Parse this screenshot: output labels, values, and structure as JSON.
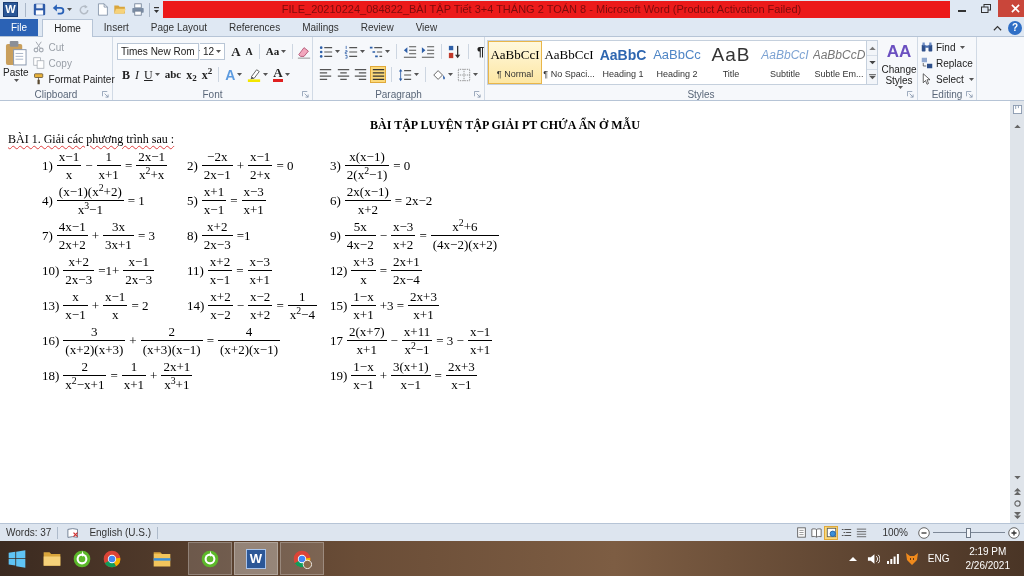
{
  "title_bar": {
    "app_glyph": "W",
    "quick_access": {
      "redo": {
        "disabled": true
      }
    },
    "title": "FILE_20210224_084822_BÀI TẬP Tiết 3+4 THÁNG 2 TOÁN 8 - Microsoft Word (Product Activation Failed)"
  },
  "tabs": [
    {
      "label": "File",
      "kind": "file",
      "selected": false
    },
    {
      "label": "Home",
      "kind": "tab",
      "selected": true
    },
    {
      "label": "Insert",
      "kind": "tab",
      "selected": false
    },
    {
      "label": "Page Layout",
      "kind": "tab",
      "selected": false
    },
    {
      "label": "References",
      "kind": "tab",
      "selected": false
    },
    {
      "label": "Mailings",
      "kind": "tab",
      "selected": false
    },
    {
      "label": "Review",
      "kind": "tab",
      "selected": false
    },
    {
      "label": "View",
      "kind": "tab",
      "selected": false
    }
  ],
  "help_glyph": "?",
  "ribbon": {
    "clipboard": {
      "label": "Clipboard",
      "paste": "Paste",
      "commands": [
        {
          "label": "Cut",
          "kind": "cut",
          "disabled": true
        },
        {
          "label": "Copy",
          "kind": "copy",
          "disabled": true
        },
        {
          "label": "Format Painter",
          "kind": "painter",
          "disabled": false
        }
      ]
    },
    "font": {
      "label": "Font",
      "font_name": "Times New Rom",
      "font_size": "12",
      "grow": "A",
      "shrink": "A",
      "change_case": "Aa",
      "bold": "B",
      "italic": "I",
      "underline": "U",
      "strikethrough": "abc",
      "subscript": "x$_{2}$",
      "superscript": "x$^{2}$",
      "text_effects": "A",
      "font_color": "A"
    },
    "paragraph": {
      "label": "Paragraph",
      "marks_glyph": "¶",
      "alignment": [
        {
          "kind": "left",
          "selected": false
        },
        {
          "kind": "center",
          "selected": false
        },
        {
          "kind": "right",
          "selected": false
        },
        {
          "kind": "justify",
          "selected": true
        }
      ]
    },
    "styles": {
      "label": "Styles",
      "items": [
        {
          "preview": "AaBbCcI",
          "name": "¶ Normal",
          "kind": "normal",
          "selected": true
        },
        {
          "preview": "AaBbCcI",
          "name": "¶ No Spaci...",
          "kind": "plain",
          "selected": false
        },
        {
          "preview": "AaBbC",
          "name": "Heading 1",
          "kind": "heading1",
          "selected": false
        },
        {
          "preview": "AaBbCc",
          "name": "Heading 2",
          "kind": "heading2",
          "selected": false
        },
        {
          "preview": "AaB",
          "name": "Title",
          "kind": "title",
          "selected": false
        },
        {
          "preview": "AaBbCcI",
          "name": "Subtitle",
          "kind": "subtitle",
          "selected": false
        },
        {
          "preview": "AaBbCcD",
          "name": "Subtle Em...",
          "kind": "emphasis",
          "selected": false
        }
      ],
      "change_styles": {
        "glyph": "AA",
        "label": "Change Styles"
      }
    },
    "editing": {
      "label": "Editing",
      "commands": [
        {
          "label": "Find",
          "kind": "find",
          "dropdown": true
        },
        {
          "label": "Replace",
          "kind": "replace",
          "dropdown": false
        },
        {
          "label": "Select",
          "kind": "select",
          "dropdown": true
        }
      ]
    }
  },
  "document": {
    "heading": "BÀI TẬP LUYỆN TẬP GIẢI PT CHỨA ẨN Ở MẪU",
    "exercise": {
      "text": "BÀI 1. Giải các phương trình sau :",
      "flagged": true
    },
    "rows": [
      [
        {
          "label": "1)",
          "terms": [
            {
              "kind": "frac",
              "num": "x−1",
              "den": "x"
            },
            {
              "kind": "text",
              "text": "−"
            },
            {
              "kind": "frac",
              "num": "1",
              "den": "x+1"
            },
            {
              "kind": "text",
              "text": "="
            },
            {
              "kind": "frac",
              "num": "2x−1",
              "den": "x$^{2}$+x"
            }
          ]
        },
        {
          "label": "2)",
          "terms": [
            {
              "kind": "frac",
              "num": "−2x",
              "den": "2x−1"
            },
            {
              "kind": "text",
              "text": "+"
            },
            {
              "kind": "frac",
              "num": "x−1",
              "den": "2+x"
            },
            {
              "kind": "text",
              "text": "= 0"
            }
          ]
        },
        {
          "label": "3)",
          "terms": [
            {
              "kind": "frac",
              "num": "x(x−1)",
              "den": "2(x$^{2}$−1)"
            },
            {
              "kind": "text",
              "text": "= 0"
            }
          ]
        }
      ],
      [
        {
          "label": "4)",
          "terms": [
            {
              "kind": "frac",
              "num": "(x−1)(x$^{2}$+2)",
              "den": "x$^{3}$−1"
            },
            {
              "kind": "text",
              "text": "= 1"
            }
          ]
        },
        {
          "label": "5)",
          "terms": [
            {
              "kind": "frac",
              "num": "x+1",
              "den": "x−1"
            },
            {
              "kind": "text",
              "text": "="
            },
            {
              "kind": "frac",
              "num": "x−3",
              "den": "x+1"
            }
          ]
        },
        {
          "label": "6)",
          "terms": [
            {
              "kind": "frac",
              "num": "2x(x−1)",
              "den": "x+2"
            },
            {
              "kind": "text",
              "text": "= 2x−2"
            }
          ]
        }
      ],
      [
        {
          "label": "7)",
          "terms": [
            {
              "kind": "frac",
              "num": "4x−1",
              "den": "2x+2"
            },
            {
              "kind": "text",
              "text": "+"
            },
            {
              "kind": "frac",
              "num": "3x",
              "den": "3x+1"
            },
            {
              "kind": "text",
              "text": "= 3"
            }
          ]
        },
        {
          "label": "8)",
          "terms": [
            {
              "kind": "frac",
              "num": "x+2",
              "den": "2x−3"
            },
            {
              "kind": "text",
              "text": "=1"
            }
          ]
        },
        {
          "label": "9)",
          "terms": [
            {
              "kind": "frac",
              "num": "5x",
              "den": "4x−2"
            },
            {
              "kind": "text",
              "text": "−"
            },
            {
              "kind": "frac",
              "num": "x−3",
              "den": "x+2"
            },
            {
              "kind": "text",
              "text": "="
            },
            {
              "kind": "frac",
              "num": "x$^{2}$+6",
              "den": "(4x−2)(x+2)"
            }
          ]
        }
      ],
      [
        {
          "label": "10)",
          "terms": [
            {
              "kind": "frac",
              "num": "x+2",
              "den": "2x−3"
            },
            {
              "kind": "text",
              "text": "=1+"
            },
            {
              "kind": "frac",
              "num": "x−1",
              "den": "2x−3"
            }
          ]
        },
        {
          "label": "11)",
          "terms": [
            {
              "kind": "frac",
              "num": "x+2",
              "den": "x−1"
            },
            {
              "kind": "text",
              "text": "="
            },
            {
              "kind": "frac",
              "num": "x−3",
              "den": "x+1"
            }
          ]
        },
        {
          "label": "12)",
          "terms": [
            {
              "kind": "frac",
              "num": "x+3",
              "den": "x"
            },
            {
              "kind": "text",
              "text": "="
            },
            {
              "kind": "frac",
              "num": "2x+1",
              "den": "2x−4"
            }
          ]
        }
      ],
      [
        {
          "label": "13)",
          "terms": [
            {
              "kind": "frac",
              "num": "x",
              "den": "x−1"
            },
            {
              "kind": "text",
              "text": "+"
            },
            {
              "kind": "frac",
              "num": "x−1",
              "den": "x"
            },
            {
              "kind": "text",
              "text": "= 2"
            }
          ]
        },
        {
          "label": "14)",
          "terms": [
            {
              "kind": "frac",
              "num": "x+2",
              "den": "x−2"
            },
            {
              "kind": "text",
              "text": "−"
            },
            {
              "kind": "frac",
              "num": "x−2",
              "den": "x+2"
            },
            {
              "kind": "text",
              "text": "="
            },
            {
              "kind": "frac",
              "num": "1",
              "den": "x$^{2}$−4"
            }
          ]
        },
        {
          "label": "15)",
          "terms": [
            {
              "kind": "frac",
              "num": "1−x",
              "den": "x+1"
            },
            {
              "kind": "text",
              "text": "+3 ="
            },
            {
              "kind": "frac",
              "num": "2x+3",
              "den": "x+1"
            }
          ]
        }
      ],
      [
        {
          "label": "16)",
          "terms": [
            {
              "kind": "frac",
              "num": "3",
              "den": "(x+2)(x+3)"
            },
            {
              "kind": "text",
              "text": "+"
            },
            {
              "kind": "frac",
              "num": "2",
              "den": "(x+3)(x−1)"
            },
            {
              "kind": "text",
              "text": "="
            },
            {
              "kind": "frac",
              "num": "4",
              "den": "(x+2)(x−1)"
            }
          ]
        },
        {
          "label": "17",
          "terms": [
            {
              "kind": "frac",
              "num": "2(x+7)",
              "den": "x+1"
            },
            {
              "kind": "text",
              "text": "−"
            },
            {
              "kind": "frac",
              "num": "x+11",
              "den": "x$^{2}$−1"
            },
            {
              "kind": "text",
              "text": "= 3 −"
            },
            {
              "kind": "frac",
              "num": "x−1",
              "den": "x+1"
            }
          ]
        }
      ],
      [
        {
          "label": "18)",
          "terms": [
            {
              "kind": "frac",
              "num": "2",
              "den": "x$^{2}$−x+1"
            },
            {
              "kind": "text",
              "text": "="
            },
            {
              "kind": "frac",
              "num": "1",
              "den": "x+1"
            },
            {
              "kind": "text",
              "text": "+"
            },
            {
              "kind": "frac",
              "num": "2x+1",
              "den": "x$^{3}$+1"
            }
          ]
        },
        {
          "label": "19)",
          "terms": [
            {
              "kind": "frac",
              "num": "1−x",
              "den": "x−1"
            },
            {
              "kind": "text",
              "text": "+"
            },
            {
              "kind": "frac",
              "num": "3(x+1)",
              "den": "x−1"
            },
            {
              "kind": "text",
              "text": "="
            },
            {
              "kind": "frac",
              "num": "2x+3",
              "den": "x−1"
            }
          ]
        }
      ]
    ]
  },
  "status_bar": {
    "words": "Words: 37",
    "language": "English (U.S.)",
    "views": [
      {
        "kind": "print",
        "selected": false
      },
      {
        "kind": "reading",
        "selected": false
      },
      {
        "kind": "web",
        "selected": true
      },
      {
        "kind": "outline",
        "selected": false
      },
      {
        "kind": "draft",
        "selected": false
      }
    ],
    "zoom": "100%",
    "zoom_slider": {
      "level": 0.5
    }
  },
  "taskbar": {
    "items": [
      {
        "kind": "folder",
        "running": false,
        "selected": false
      },
      {
        "kind": "ring",
        "running": false,
        "selected": false
      },
      {
        "kind": "chrome",
        "running": false,
        "selected": false
      },
      {
        "kind": "explorer",
        "running": false,
        "selected": false
      },
      {
        "kind": "ring",
        "running": true,
        "selected": false
      },
      {
        "kind": "word",
        "glyph": "W",
        "running": true,
        "selected": true
      },
      {
        "kind": "chrome_profile",
        "running": true,
        "selected": false
      }
    ],
    "language": "ENG",
    "time": "2:19 PM",
    "date": "2/26/2021"
  }
}
